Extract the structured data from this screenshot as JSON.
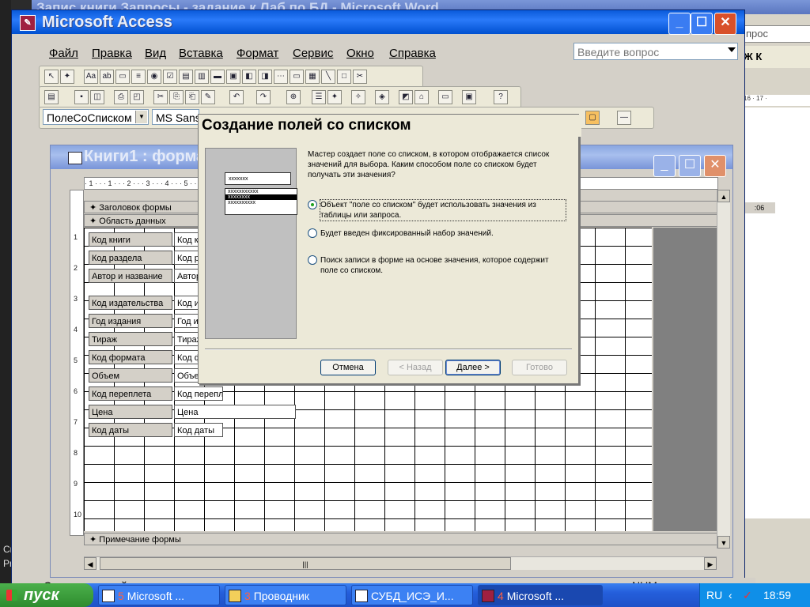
{
  "word": {
    "title": "Запис книги  Запросы - задание к Лаб по БД - Microsoft Word",
    "help_placeholder": "прос",
    "format_buttons": "Ж К",
    "ruler_text": "16 · 17 ·",
    "time_cell": ":06",
    "left_texts": [
      "Crea",
      "Prod"
    ]
  },
  "access": {
    "title": "Microsoft Access",
    "menu": [
      "Файл",
      "Правка",
      "Вид",
      "Вставка",
      "Формат",
      "Сервис",
      "Окно",
      "Справка"
    ],
    "help_placeholder": "Введите вопрос",
    "combo_control": "ПолеСоСписком",
    "combo_font": "MS Sans",
    "status": "Создание полей со списком",
    "status_num": "NUM"
  },
  "form_window": {
    "title": "Книги1 : форма",
    "ruler": "· 1 · · · 1 · · · 2 · · · 3 · · · 4 · · · 5 · · · 6 · · · 7 · · · 8 · · · 9 · · · 10 · · · 11 · · · 12 · · · 13 · · · 14 · · · 15 · · · 16 · · · 17 · · 18 · · 19 · · 20 · · 2",
    "section_header": "Заголовок формы",
    "section_detail": "Область данных",
    "section_footer": "Примечание формы",
    "vruler": [
      "1",
      "2",
      "3",
      "4",
      "5",
      "6",
      "7",
      "8",
      "9",
      "10"
    ],
    "fields": [
      {
        "label": "Код книги",
        "box": "Код книги"
      },
      {
        "label": "Код раздела",
        "box": "Код раздела"
      },
      {
        "label": "Автор и название",
        "box": "Автор и название"
      },
      {
        "label": "Код издательства",
        "box": "Код издательства"
      },
      {
        "label": "Год издания",
        "box": "Год издания"
      },
      {
        "label": "Тираж",
        "box": "Тираж"
      },
      {
        "label": "Код формата",
        "box": "Код формата"
      },
      {
        "label": "Объем",
        "box": "Объем"
      },
      {
        "label": "Код переплета",
        "box": "Код переплета"
      },
      {
        "label": "Цена",
        "box": "Цена"
      },
      {
        "label": "Код даты",
        "box": "Код даты"
      }
    ]
  },
  "dialog": {
    "title": "Создание полей со списком",
    "sample_combo": "xxxxxxx",
    "sample_items": [
      "xxxxxxxxxxx",
      "xxxxxxxx",
      "xxxxxxxxxx"
    ],
    "description": "Мастер создает поле со списком, в котором отображается список значений для выбора.  Каким способом поле со списком будет получать эти значения?",
    "options": [
      {
        "text": "Объект \"поле со списком\" будет использовать значения из таблицы или запроса.",
        "selected": true
      },
      {
        "text": "Будет введен фиксированный набор значений.",
        "selected": false
      },
      {
        "text": "Поиск записи в форме на основе значения, которое содержит поле со списком.",
        "selected": false
      }
    ],
    "buttons": {
      "cancel": "Отмена",
      "back": "< Назад",
      "next": "Далее >",
      "finish": "Готово"
    }
  },
  "taskbar": {
    "start": "пуск",
    "tasks": [
      {
        "num": "5",
        "label": "Microsoft ..."
      },
      {
        "num": "3",
        "label": "Проводник"
      },
      {
        "num": "",
        "label": "СУБД_ИСЭ_И..."
      },
      {
        "num": "4",
        "label": "Microsoft ..."
      }
    ],
    "lang": "RU",
    "clock": "18:59"
  }
}
